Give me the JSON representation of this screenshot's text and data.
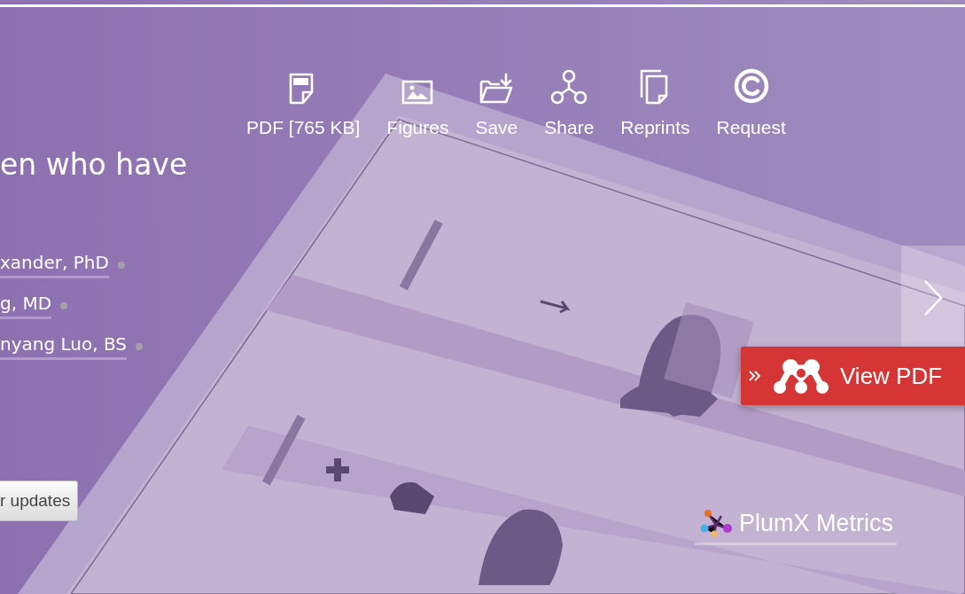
{
  "toolbar": [
    {
      "kind": "pdf",
      "label": "PDF [765 KB]"
    },
    {
      "kind": "figures",
      "label": "Figures"
    },
    {
      "kind": "save",
      "label": "Save"
    },
    {
      "kind": "share",
      "label": "Share"
    },
    {
      "kind": "reprints",
      "label": "Reprints"
    },
    {
      "kind": "request",
      "label": "Request"
    }
  ],
  "title_fragment": "en who have",
  "authors": [
    {
      "name": "xander, PhD"
    },
    {
      "name": "g, MD"
    },
    {
      "name": "nyang Luo, BS"
    }
  ],
  "alerts_button": "r updates",
  "view_pdf": {
    "label": "View PDF"
  },
  "metrics": {
    "label": "PlumX Metrics"
  }
}
